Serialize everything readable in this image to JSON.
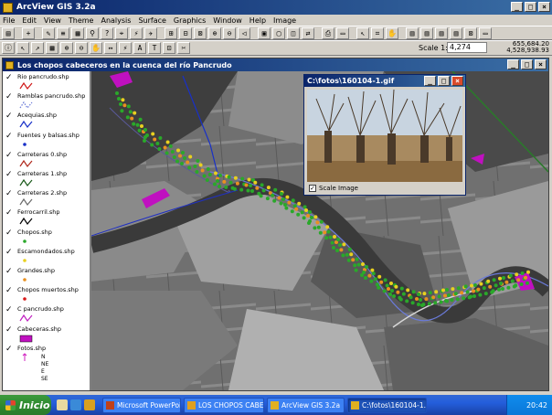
{
  "app": {
    "title": "ArcView GIS 3.2a"
  },
  "menu": [
    "File",
    "Edit",
    "View",
    "Theme",
    "Analysis",
    "Surface",
    "Graphics",
    "Window",
    "Help",
    "Image"
  ],
  "toolbar": {
    "scale_label": "Scale 1:",
    "scale_value": "4,274",
    "coord_x": "655,684.20",
    "coord_y": "4,528,938.93"
  },
  "map_window": {
    "title": "Los chopos cabeceros en la cuenca del río Pancrudo"
  },
  "legend": [
    {
      "label": "Rio pancrudo.shp",
      "symbol": "line",
      "color": "#d01818"
    },
    {
      "label": "Ramblas pancrudo.shp",
      "symbol": "dashed",
      "color": "#6a7ad8"
    },
    {
      "label": "Acequias.shp",
      "symbol": "line",
      "color": "#1830c8"
    },
    {
      "label": "Fuentes y balsas.shp",
      "symbol": "dot",
      "color": "#1830c8"
    },
    {
      "label": "Carreteras 0.shp",
      "symbol": "line",
      "color": "#b0281c"
    },
    {
      "label": "Carreteras 1.shp",
      "symbol": "line",
      "color": "#1a5a1a"
    },
    {
      "label": "Carreteras 2.shp",
      "symbol": "line",
      "color": "#6a6a6a"
    },
    {
      "label": "Ferrocarril.shp",
      "symbol": "line",
      "color": "#000000"
    },
    {
      "label": "Chopos.shp",
      "symbol": "dot",
      "color": "#2aa82a"
    },
    {
      "label": "Escamondados.shp",
      "symbol": "dot",
      "color": "#e8d020"
    },
    {
      "label": "Grandes.shp",
      "symbol": "dot",
      "color": "#e89020"
    },
    {
      "label": "Chopos muertos.shp",
      "symbol": "dot",
      "color": "#d81818"
    },
    {
      "label": "C pancrudo.shp",
      "symbol": "line",
      "color": "#c020c0"
    },
    {
      "label": "Cabeceras.shp",
      "symbol": "fill",
      "color": "#c010c0"
    },
    {
      "label": "Fotos.shp",
      "symbol": "arrows",
      "color": "#d020c0",
      "sub": [
        "N",
        "NE",
        "E",
        "SE"
      ]
    }
  ],
  "photo_window": {
    "title": "C:\\fotos\\160104-1.gif",
    "scale_checkbox": "Scale Image"
  },
  "taskbar": {
    "start": "Inicio",
    "items": [
      {
        "label": "Microsoft PowerPoint ...",
        "color": "#c0401a"
      },
      {
        "label": "LOS CHOPOS CABEC...",
        "color": "#e0a020"
      },
      {
        "label": "ArcView GIS 3.2a",
        "color": "#e0b020"
      },
      {
        "label": "C:\\fotos\\160104-1.gif",
        "color": "#e0b020"
      }
    ],
    "clock": "20:42"
  }
}
